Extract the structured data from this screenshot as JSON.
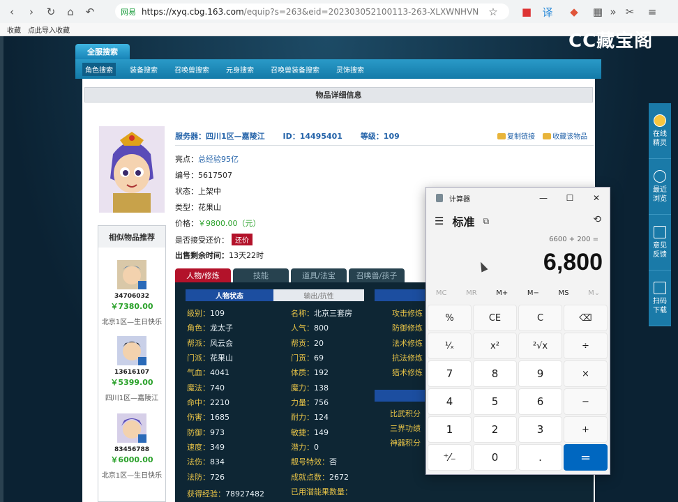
{
  "browser": {
    "security_label": "网易",
    "url_host": "https://xyq.cbg.163.com",
    "url_path": "/equip?s=263&eid=202303052100113-263-XLXWNHVN",
    "bookmarks": [
      "收藏",
      "点此导入收藏"
    ]
  },
  "site": {
    "logo": "CC藏宝阁",
    "search_tab": "全服搜索",
    "nav": [
      "角色搜索",
      "装备搜索",
      "召唤兽搜索",
      "元身搜索",
      "召唤兽装备搜索",
      "灵饰搜索"
    ],
    "section_title": "物品详细信息"
  },
  "item": {
    "server_label": "服务器：四川1区—嘉陵江",
    "id_label": "ID：14495401",
    "level_label": "等级：109",
    "copy_link": "复制链接",
    "favorite": "收藏该物品",
    "highlight_label": "亮点：",
    "highlight_value": "总经验95亿",
    "number_label": "编号：",
    "number_value": "5617507",
    "status_label": "状态：",
    "status_value": "上架中",
    "type_label": "类型：",
    "type_value": "花果山",
    "price_label": "价格：",
    "price_value": "￥9800.00（元）",
    "bargain_label": "是否接受还价：",
    "bargain_button": "还价",
    "remaining_label": "出售剩余时间：",
    "remaining_value": "13天22时"
  },
  "similar": {
    "title": "相似物品推荐",
    "items": [
      {
        "id": "34706032",
        "price": "￥7380.00",
        "server": "北京1区—生日快乐"
      },
      {
        "id": "13616107",
        "price": "￥5399.00",
        "server": "四川1区—嘉陵江"
      },
      {
        "id": "83456788",
        "price": "￥6000.00",
        "server": "北京1区—生日快乐"
      }
    ]
  },
  "tabs": [
    "人物/修炼",
    "技能",
    "道具/法宝",
    "召唤兽/孩子"
  ],
  "subtabs": [
    "人物状态",
    "输出/抗性"
  ],
  "stats": [
    {
      "label": "级别：",
      "value": "109"
    },
    {
      "label": "角色：",
      "value": "龙太子"
    },
    {
      "label": "帮派：",
      "value": "风云会"
    },
    {
      "label": "门派：",
      "value": "花果山"
    },
    {
      "label": "气血：",
      "value": "4041"
    },
    {
      "label": "魔法：",
      "value": "740"
    },
    {
      "label": "命中：",
      "value": "2210"
    },
    {
      "label": "伤害：",
      "value": "1685"
    },
    {
      "label": "防御：",
      "value": "973"
    },
    {
      "label": "速度：",
      "value": "349"
    },
    {
      "label": "法伤：",
      "value": "834"
    },
    {
      "label": "法防：",
      "value": "726"
    },
    {
      "label": "获得经验：",
      "value": "78927482"
    }
  ],
  "stats2": [
    {
      "label": "名称：",
      "value": "北京三套房"
    },
    {
      "label": "人气：",
      "value": "800"
    },
    {
      "label": "帮贡：",
      "value": "20"
    },
    {
      "label": "门贡：",
      "value": "69"
    },
    {
      "label": "体质：",
      "value": "192"
    },
    {
      "label": "魔力：",
      "value": "138"
    },
    {
      "label": "力量：",
      "value": "756"
    },
    {
      "label": "耐力：",
      "value": "124"
    },
    {
      "label": "敏捷：",
      "value": "149"
    },
    {
      "label": "潜力：",
      "value": "0"
    },
    {
      "label": "靓号特效：",
      "value": "否"
    },
    {
      "label": "成就点数：",
      "value": "2672"
    },
    {
      "label": "已用潜能果数量：",
      "value": ""
    }
  ],
  "stats3": [
    "攻击修炼",
    "防御修炼",
    "法术修炼",
    "抗法修炼",
    "猎术修炼"
  ],
  "stats4": [
    "比武积分",
    "三界功绩",
    "神器积分"
  ],
  "sidebar": [
    {
      "label1": "在线",
      "label2": "精灵"
    },
    {
      "label1": "最近",
      "label2": "浏览"
    },
    {
      "label1": "意见",
      "label2": "反馈"
    },
    {
      "label1": "扫码",
      "label2": "下载"
    }
  ],
  "calculator": {
    "title": "计算器",
    "mode": "标准",
    "expression": "6600 + 200 =",
    "display": "6,800",
    "memory": [
      "MC",
      "MR",
      "M+",
      "M−",
      "MS",
      "M⌄"
    ],
    "keys": [
      "%",
      "CE",
      "C",
      "⌫",
      "¹⁄ₓ",
      "x²",
      "²√x",
      "÷",
      "7",
      "8",
      "9",
      "×",
      "4",
      "5",
      "6",
      "−",
      "1",
      "2",
      "3",
      "+",
      "⁺⁄₋",
      "0",
      ".",
      "="
    ]
  }
}
